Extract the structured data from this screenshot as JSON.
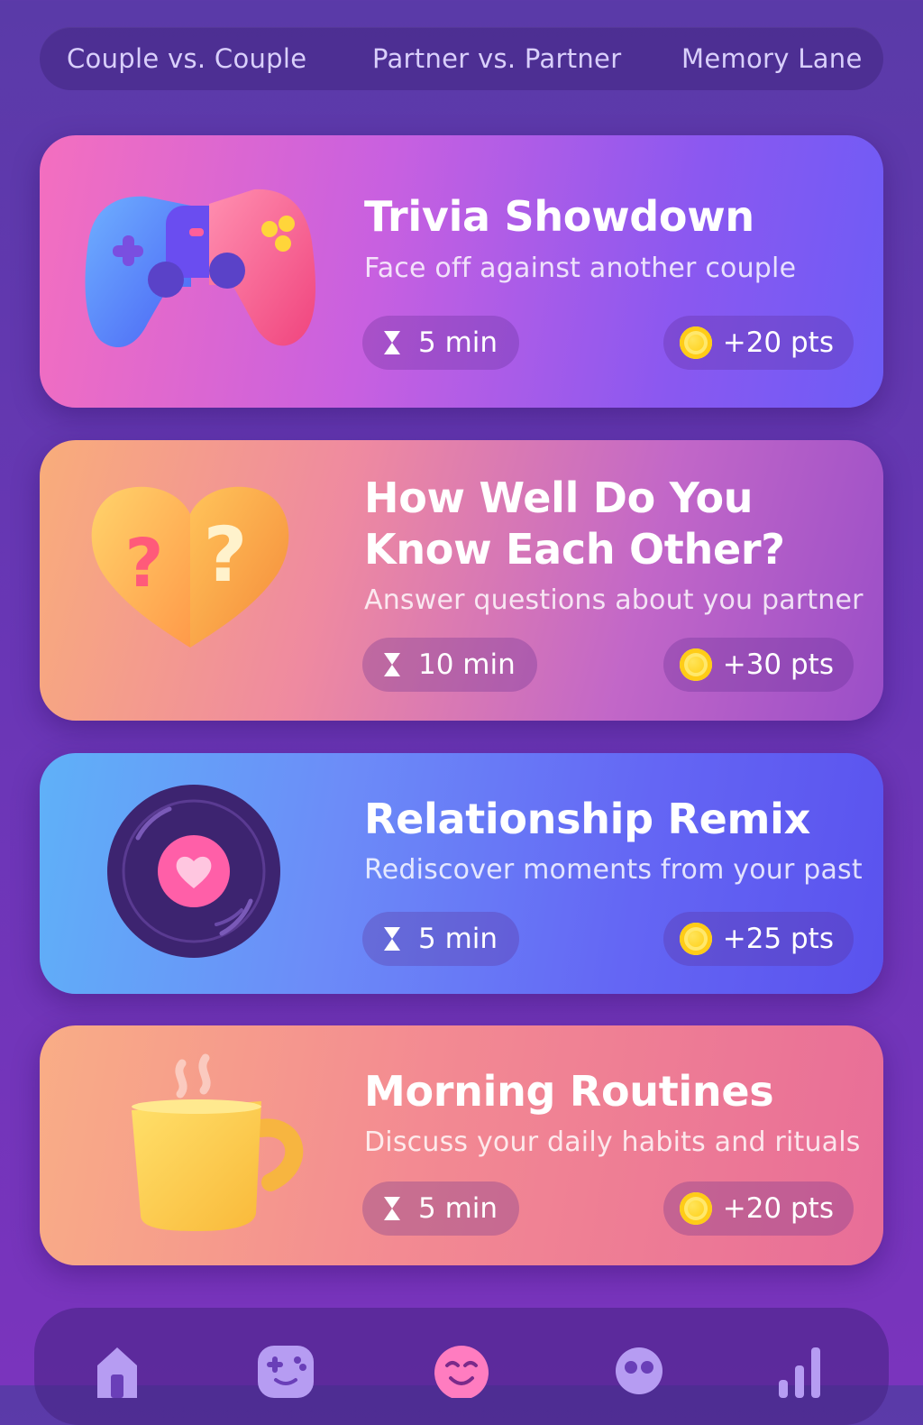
{
  "tabs": [
    {
      "label": "Couple vs. Couple"
    },
    {
      "label": "Partner vs. Partner"
    },
    {
      "label": "Memory Lane"
    }
  ],
  "games": [
    {
      "title": "Trivia Showdown",
      "subtitle": "Face off against another couple",
      "time": "5 min",
      "points": "+20 pts",
      "icon": "gamepad-icon"
    },
    {
      "title_line1": "How Well Do You",
      "title_line2": "Know Each Other?",
      "subtitle": "Answer questions about you partner",
      "time": "10 min",
      "points": "+30 pts",
      "icon": "question-heart-icon"
    },
    {
      "title": "Relationship Remix",
      "subtitle": "Rediscover moments from your past",
      "time": "5 min",
      "points": "+25 pts",
      "icon": "vinyl-record-icon"
    },
    {
      "title": "Morning Routines",
      "subtitle": "Discuss your daily habits and rituals",
      "time": "5 min",
      "points": "+20 pts",
      "icon": "coffee-mug-icon"
    }
  ],
  "nav": [
    {
      "icon": "home-icon"
    },
    {
      "icon": "game-controller-icon"
    },
    {
      "icon": "smiley-face-icon"
    },
    {
      "icon": "mask-icon"
    },
    {
      "icon": "stats-bars-icon"
    }
  ],
  "colors": {
    "background": "#6a36b6",
    "coin": "#ffd21f"
  }
}
